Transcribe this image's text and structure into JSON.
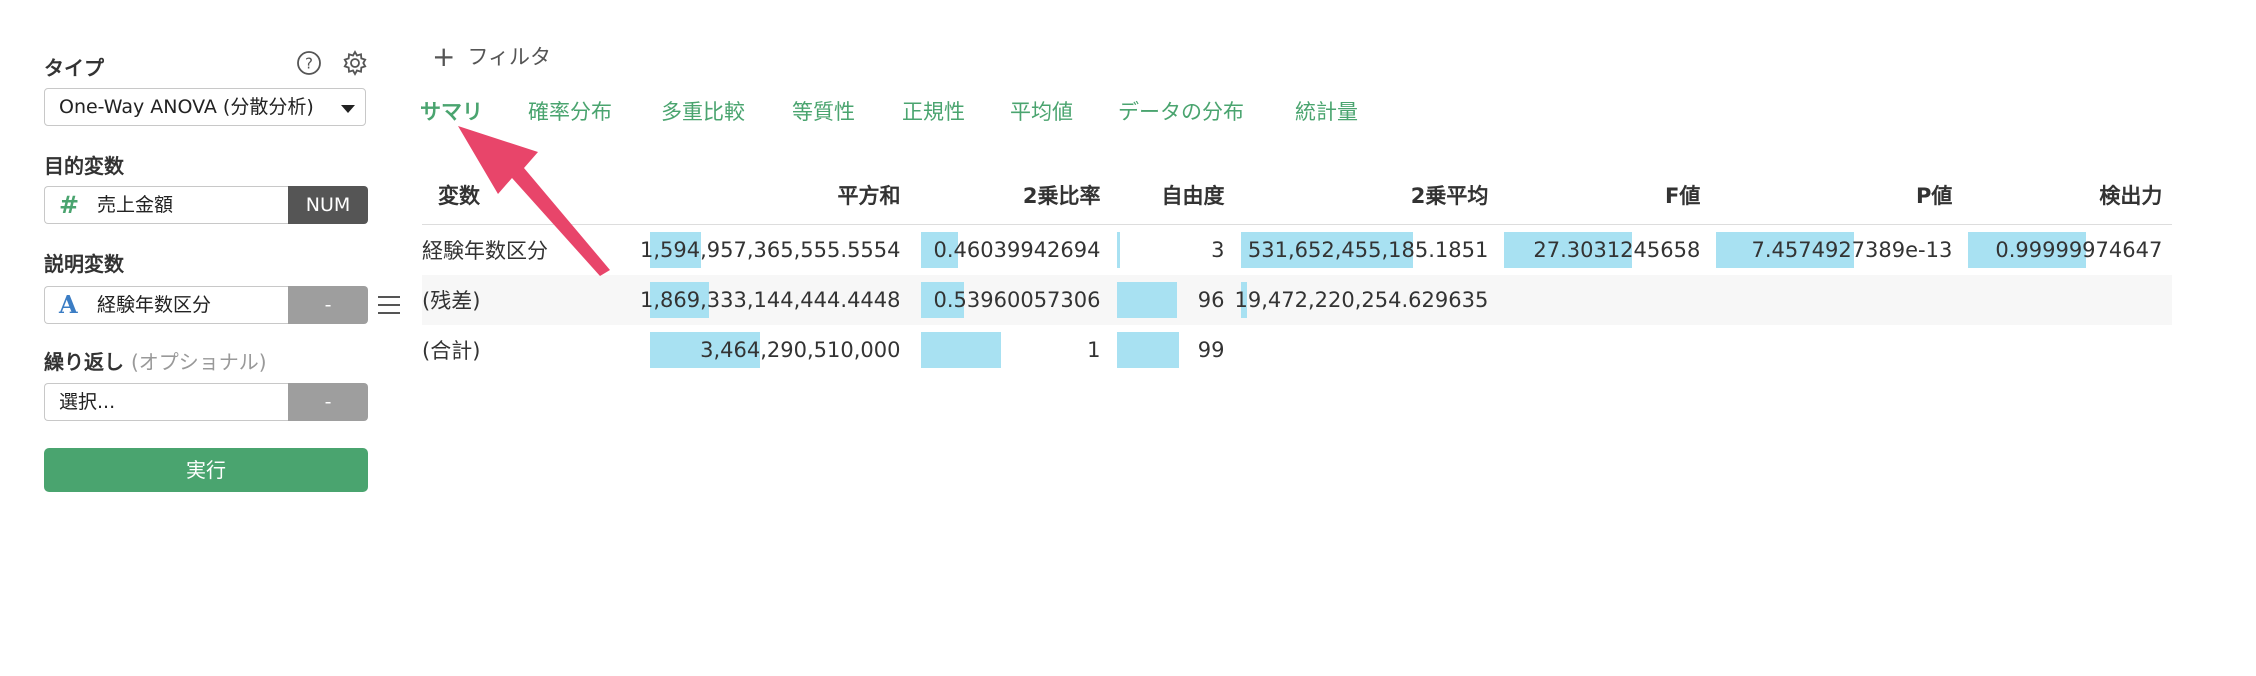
{
  "panel": {
    "type_label": "タイプ",
    "type_value": "One-Way ANOVA (分散分析)",
    "target_label": "目的変数",
    "target_icon": "#",
    "target_value": "売上金額",
    "target_tag": "NUM",
    "explain_label": "説明変数",
    "explain_icon": "A",
    "explain_value": "経験年数区分",
    "explain_tag": "-",
    "repeat_label": "繰り返し",
    "repeat_optional": "(オプショナル)",
    "repeat_placeholder": "選択...",
    "repeat_tag": "-",
    "run_label": "実行"
  },
  "filter_label": "フィルタ",
  "tabs": [
    {
      "label": "サマリ"
    },
    {
      "label": "確率分布"
    },
    {
      "label": "多重比較"
    },
    {
      "label": "等質性"
    },
    {
      "label": "正規性"
    },
    {
      "label": "平均値"
    },
    {
      "label": "データの分布"
    },
    {
      "label": "統計量"
    }
  ],
  "table": {
    "headers": [
      "変数",
      "平方和",
      "2乗比率",
      "自由度",
      "2乗平均",
      "F値",
      "P値",
      "検出力"
    ],
    "rows": [
      {
        "cells": [
          "経験年数区分",
          "1,594,957,365,555.5554",
          "0.46039942694",
          "3",
          "531,652,455,185.1851",
          "27.3031245658",
          "7.4574927389e-13",
          "0.99999974647"
        ],
        "fill": [
          null,
          0.46,
          0.46,
          0.03,
          1.0,
          1.0,
          1.0,
          1.0
        ]
      },
      {
        "cells": [
          "(残差)",
          "1,869,333,144,444.4448",
          "0.53960057306",
          "96",
          "19,472,220,254.629635",
          "",
          "",
          ""
        ],
        "fill": [
          null,
          0.54,
          0.54,
          0.97,
          0.037,
          null,
          null,
          null
        ]
      },
      {
        "cells": [
          "(合計)",
          "3,464,290,510,000",
          "1",
          "99",
          "",
          "",
          "",
          ""
        ],
        "fill": [
          null,
          1.0,
          1.0,
          1.0,
          null,
          null,
          null,
          null
        ]
      }
    ]
  },
  "colors": {
    "accent_green": "#4aa46f",
    "bar_blue": "#a8e1f2",
    "arrow_pink": "#e8456a"
  }
}
